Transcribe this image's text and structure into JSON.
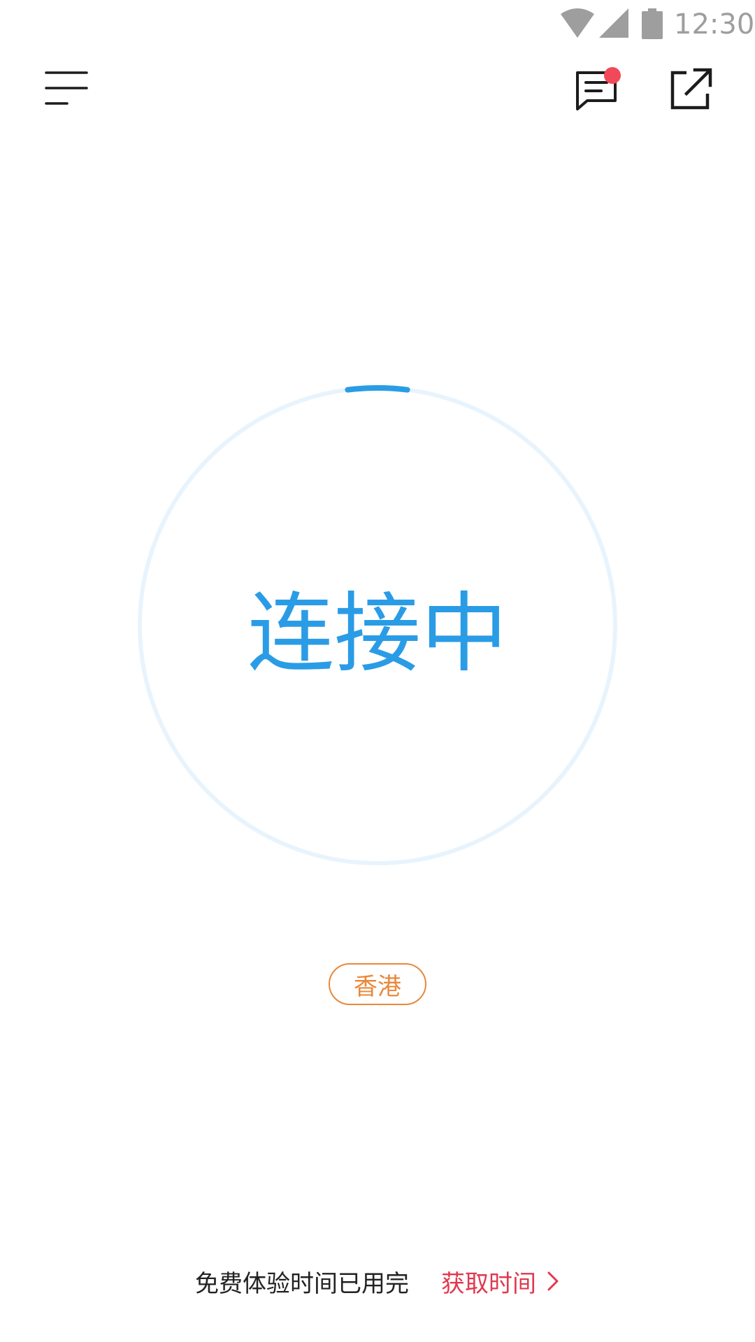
{
  "status_bar": {
    "time": "12:30",
    "icons": [
      "wifi-icon",
      "cellular-signal-icon",
      "battery-icon"
    ]
  },
  "toolbar": {
    "menu_icon": "hamburger-menu-icon",
    "message_icon": "message-icon",
    "message_has_unread": true,
    "share_icon": "external-link-icon"
  },
  "connection": {
    "status_text": "连接中",
    "progress": 0.04
  },
  "region": {
    "label": "香港"
  },
  "footer": {
    "trial_message": "免费体验时间已用完",
    "get_time_label": "获取时间",
    "chevron_icon": "chevron-right-icon"
  },
  "colors": {
    "accent_blue": "#2a9ce6",
    "ring_track": "#e8f4fd",
    "region_orange": "#e8883a",
    "cta_red": "#e0394e",
    "badge_red": "#f2495a",
    "icon_dark": "#1c1c1c",
    "status_gray": "#9e9e9e"
  }
}
